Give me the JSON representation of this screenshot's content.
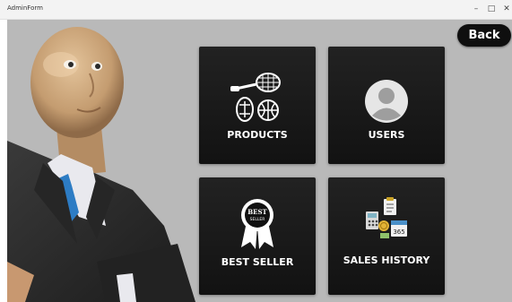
{
  "window": {
    "title": "AdminForm",
    "minimize_glyph": "–",
    "maximize_glyph": "□",
    "close_glyph": "✕"
  },
  "header": {
    "back_label": "Back"
  },
  "tiles": [
    {
      "label": "PRODUCTS",
      "icon": "sports-equipment-icon"
    },
    {
      "label": "USERS",
      "icon": "user-avatar-icon"
    },
    {
      "label": "BEST SELLER",
      "icon": "best-seller-badge-icon",
      "badge_text_1": "BEST",
      "badge_text_2": "SELLER"
    },
    {
      "label": "SALES HISTORY",
      "icon": "sales-history-icon",
      "calendar_number": "365"
    }
  ],
  "colors": {
    "background": "#b9b9b9",
    "tile": "#1a1a1a",
    "button": "#0f0f0f",
    "text": "#ffffff"
  }
}
